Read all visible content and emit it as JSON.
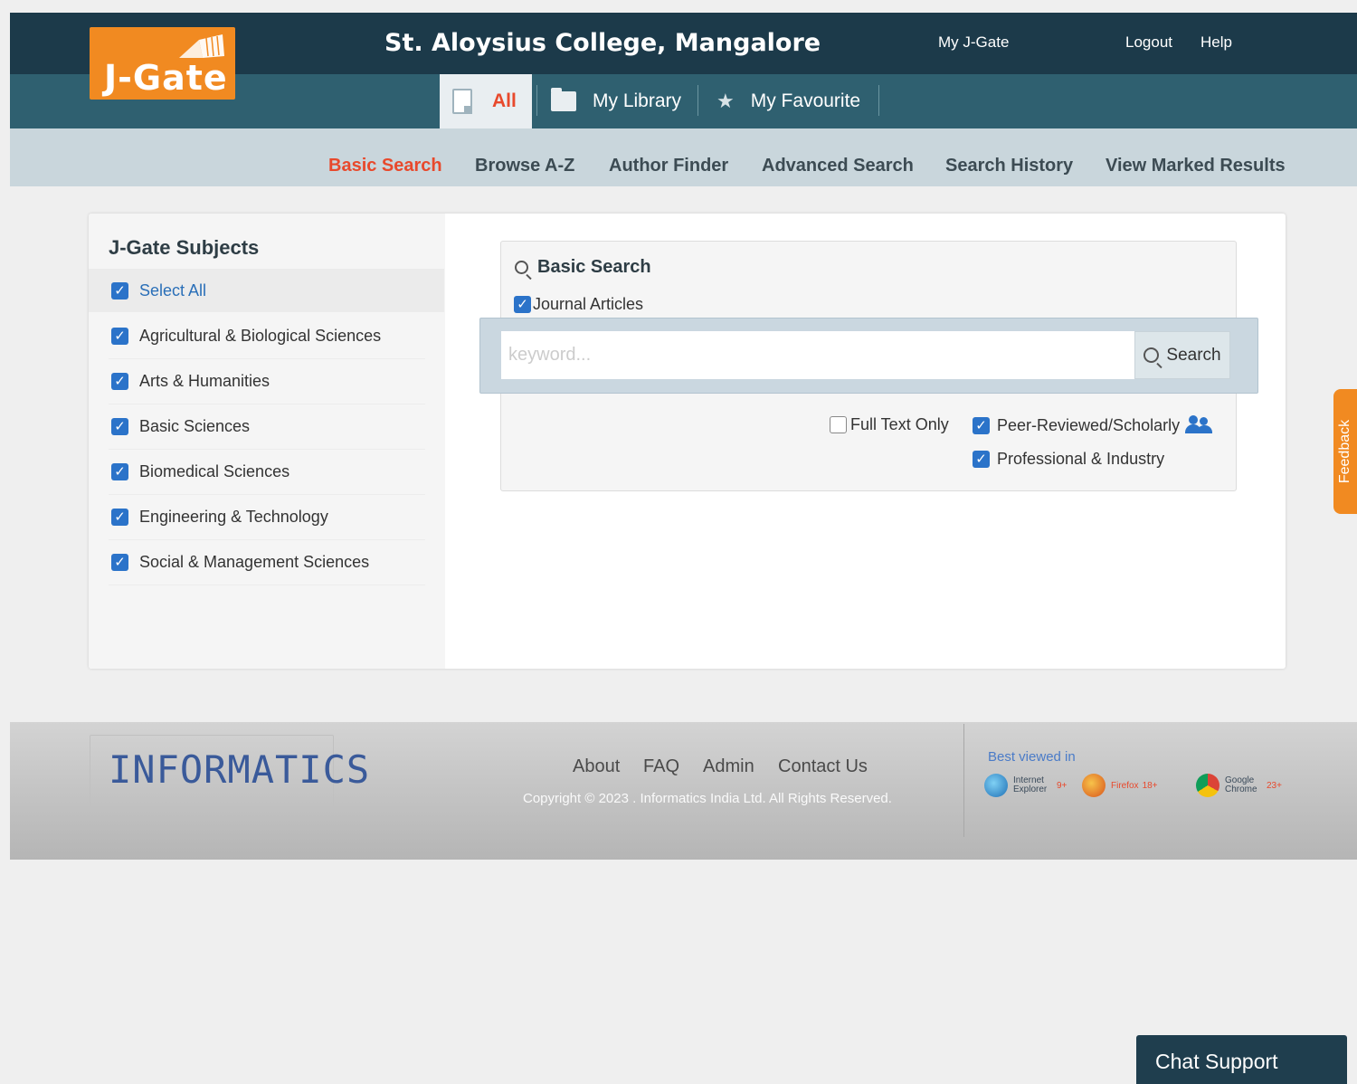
{
  "header": {
    "logo_text": "J-Gate",
    "college": "St. Aloysius College, Mangalore",
    "links": [
      "My J-Gate",
      "Logout",
      "Help"
    ]
  },
  "tabs": [
    {
      "label": "All",
      "icon": "document-icon",
      "active": true
    },
    {
      "label": "My Library",
      "icon": "folder-icon"
    },
    {
      "label": "My Favourite",
      "icon": "star-icon"
    }
  ],
  "search_nav": {
    "items": [
      "Basic Search",
      "Browse A-Z",
      "Author Finder",
      "Advanced Search",
      "Search History",
      "View Marked Results"
    ],
    "active": "Basic Search"
  },
  "sidebar": {
    "title": "J-Gate Subjects",
    "select_all": "Select All",
    "subjects": [
      "Agricultural & Biological Sciences",
      "Arts & Humanities",
      "Basic Sciences",
      "Biomedical Sciences",
      "Engineering & Technology",
      "Social & Management Sciences"
    ]
  },
  "search": {
    "title": "Basic Search",
    "journal_label": "Journal Articles",
    "placeholder": "keyword...",
    "button": "Search",
    "options": {
      "full_text": "Full Text Only",
      "peer_reviewed": "Peer-Reviewed/Scholarly",
      "professional": "Professional & Industry"
    }
  },
  "feedback": "Feedback",
  "footer": {
    "logo_text": "INFORMATICS",
    "links": [
      "About",
      "FAQ",
      "Admin",
      "Contact Us"
    ],
    "copyright": "Copyright © 2023 . Informatics India Ltd. All Rights Reserved.",
    "best_viewed": "Best viewed in",
    "browsers": [
      {
        "name": "Internet Explorer",
        "version": "9+"
      },
      {
        "name": "Firefox",
        "version": "18+"
      },
      {
        "name": "Google Chrome",
        "version": "23+"
      }
    ]
  },
  "chat": "Chat Support",
  "colors": {
    "accent": "#f18a21",
    "header_dark": "#1c3a4a",
    "header_teal": "#2f6070",
    "active_red": "#e8492c",
    "checkbox_blue": "#2b73c9"
  }
}
